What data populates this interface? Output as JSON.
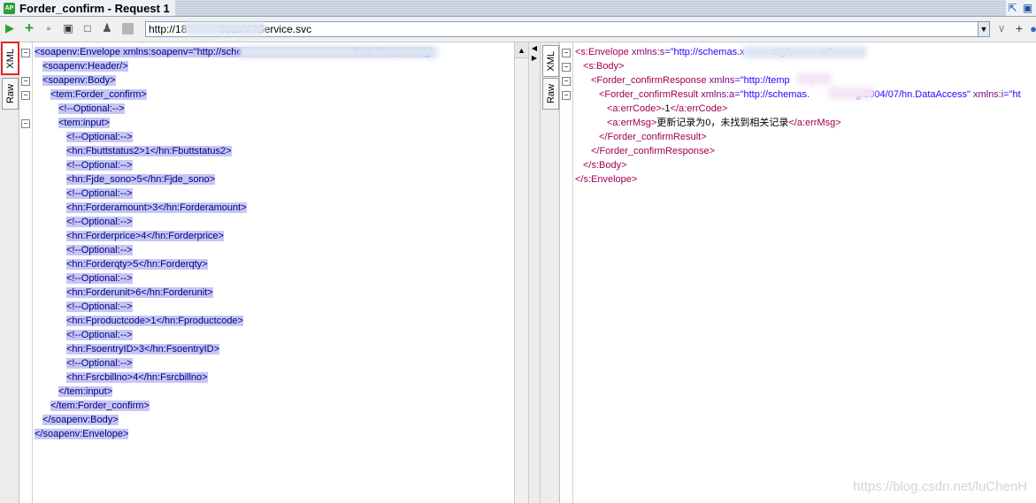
{
  "window": {
    "title": "Forder_confirm - Request 1",
    "icon_text": "AP"
  },
  "toolbar": {
    "url": "http://18           081/APIService.svc",
    "icons": [
      "run-icon",
      "add-icon",
      "format-icon",
      "expand-icon",
      "square-icon",
      "user-icon",
      "stop-icon"
    ]
  },
  "left_tabs": {
    "xml": "XML",
    "raw": "Raw"
  },
  "right_tabs": {
    "xml": "XML",
    "raw": "Raw"
  },
  "request_lines": [
    "<soapenv:Envelope xmlns:soapenv=\"http://sche                                         \"http://tempuri.org/",
    "<soapenv:Header/>",
    "<soapenv:Body>",
    "<tem:Forder_confirm>",
    "<!--Optional:-->",
    "<tem:input>",
    "<!--Optional:-->",
    "<hn:Fbuttstatus2>1</hn:Fbuttstatus2>",
    "<!--Optional:-->",
    "<hn:Fjde_sono>5</hn:Fjde_sono>",
    "<!--Optional:-->",
    "<hn:Forderamount>3</hn:Forderamount>",
    "<!--Optional:-->",
    "<hn:Forderprice>4</hn:Forderprice>",
    "<!--Optional:-->",
    "<hn:Forderqty>5</hn:Forderqty>",
    "<!--Optional:-->",
    "<hn:Forderunit>6</hn:Forderunit>",
    "<!--Optional:-->",
    "<hn:Fproductcode>1</hn:Fproductcode>",
    "<!--Optional:-->",
    "<hn:FsoentryID>3</hn:FsoentryID>",
    "<!--Optional:-->",
    "<hn:Fsrcbillno>4</hn:Fsrcbillno>",
    "</tem:input>",
    "</tem:Forder_confirm>",
    "</soapenv:Body>",
    "</soapenv:Envelope>"
  ],
  "response_lines": [
    {
      "tag": "<s:Envelope",
      "attr": " xmlns:s",
      "val": "=\"http://schemas.x          org/s          e/\"",
      "close": ">"
    },
    {
      "tag": "<s:Body>"
    },
    {
      "tag": "<Forder_confirmResponse",
      "attr": " xmlns",
      "val": "=\"http://temp        /\"",
      "close": ">"
    },
    {
      "tag": "<Forder_confirmResult",
      "attr": " xmlns:a",
      "val": "=\"http://schemas.                 g/2004/07/hn.DataAccess\"",
      "attr2": " xmlns:i",
      "val2": "=\"ht"
    },
    {
      "tag": "<a:errCode>",
      "text": "-1",
      "tag2": "</a:errCode>"
    },
    {
      "tag": "<a:errMsg>",
      "text": "更新记录为0，未找到相关记录",
      "tag2": "</a:errMsg>"
    },
    {
      "tag": "</Forder_confirmResult>"
    },
    {
      "tag": "</Forder_confirmResponse>"
    },
    {
      "tag": "</s:Body>"
    },
    {
      "tag": "</s:Envelope>"
    }
  ],
  "watermark": "https://blog.csdn.net/luChenH"
}
